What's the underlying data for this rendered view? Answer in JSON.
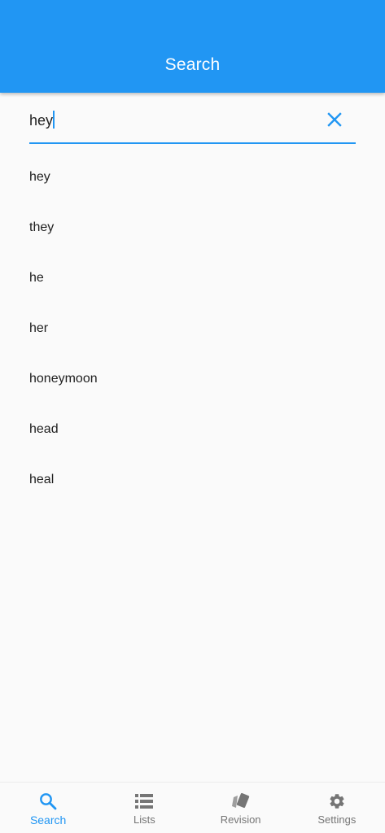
{
  "app_bar": {
    "title": "Search"
  },
  "search": {
    "value": "hey",
    "clear_icon": "close-icon"
  },
  "suggestions": [
    "hey",
    "they",
    "he",
    "her",
    "honeymoon",
    "head",
    "heal"
  ],
  "bottom_nav": {
    "items": [
      {
        "label": "Search",
        "icon": "search-icon",
        "active": true
      },
      {
        "label": "Lists",
        "icon": "list-icon",
        "active": false
      },
      {
        "label": "Revision",
        "icon": "cards-icon",
        "active": false
      },
      {
        "label": "Settings",
        "icon": "gear-icon",
        "active": false
      }
    ]
  },
  "colors": {
    "primary": "#2196f3",
    "inactive": "#757575",
    "background": "#fafafa"
  }
}
